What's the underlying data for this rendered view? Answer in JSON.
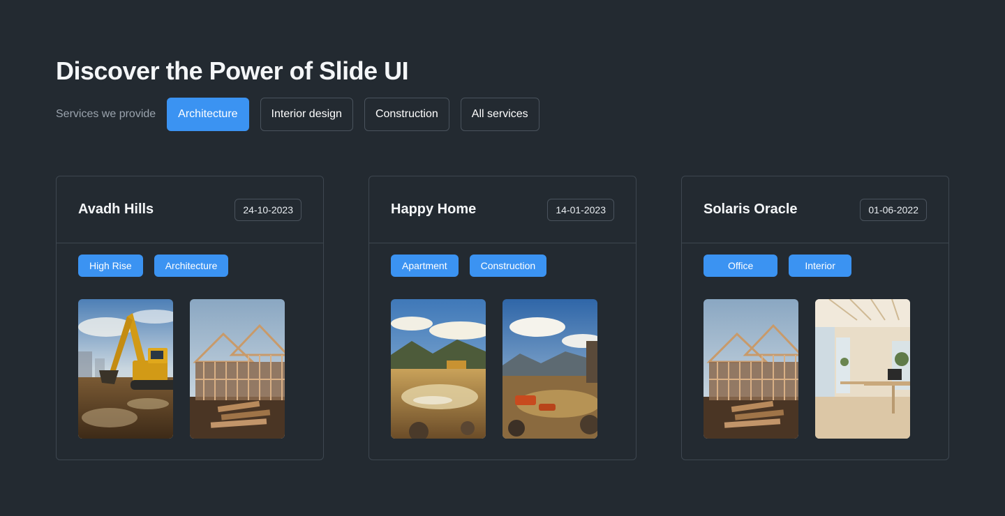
{
  "title": "Discover the Power of Slide UI",
  "services": {
    "label": "Services we provide",
    "chips": [
      "Architecture",
      "Interior design",
      "Construction",
      "All services"
    ],
    "active": "Architecture"
  },
  "cards": [
    {
      "title": "Avadh Hills",
      "date": "24-10-2023",
      "tags": [
        "High Rise",
        "Architecture"
      ],
      "photos": [
        "excavator on muddy construction site",
        "wooden house frame under construction"
      ]
    },
    {
      "title": "Happy Home",
      "date": "14-01-2023",
      "tags": [
        "Apartment",
        "Construction"
      ],
      "photos": [
        "mountain valley with muddy water reflection",
        "construction site with machinery in valley"
      ]
    },
    {
      "title": "Solaris Oracle",
      "date": "01-06-2022",
      "tags": [
        "Office",
        "Interior"
      ],
      "photos": [
        "wooden house frame under construction",
        "bright modern office interior"
      ]
    }
  ],
  "colors": {
    "background": "#232a31",
    "accent": "#3b93f2",
    "border": "#3e4750",
    "muted_text": "#9aa3ad"
  }
}
